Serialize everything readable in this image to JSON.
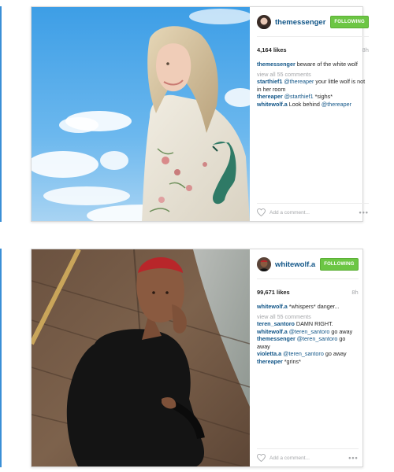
{
  "posts": [
    {
      "username": "themessenger",
      "follow_label": "FOLLOWING",
      "likes": "4,164 likes",
      "time": "8h",
      "caption_user": "themessenger",
      "caption_text": " beware of the white wolf",
      "view_all": "view all 55 comments",
      "comments": [
        {
          "user": "starthief1",
          "mention": " @thereaper",
          "text": " your little wolf is not in her room"
        },
        {
          "user": "thereaper",
          "mention": " @starthief1",
          "text": " *sighs*"
        },
        {
          "user": "whitewolf.a",
          "mention": "",
          "text": " Look behind ",
          "mention_end": "@thereaper"
        }
      ],
      "add_comment_placeholder": "Add a comment...",
      "more_icon": "ellipsis-icon",
      "like_icon": "heart-icon"
    },
    {
      "username": "whitewolf.a",
      "follow_label": "FOLLOWING",
      "likes": "99,671 likes",
      "time": "8h",
      "caption_user": "whitewolf.a",
      "caption_text": " *whispers* danger...",
      "view_all": "view all 55 comments",
      "comments": [
        {
          "user": "teren_santoro",
          "mention": "",
          "text": " DAMN RIGHT."
        },
        {
          "user": "whitewolf.a",
          "mention": " @teren_santoro",
          "text": " go away"
        },
        {
          "user": "themessenger",
          "mention": " @teren_santoro",
          "text": " go away"
        },
        {
          "user": "violetta.a",
          "mention": " @teren_santoro",
          "text": " go away"
        },
        {
          "user": "thereaper",
          "mention": "",
          "text": " *grins*"
        }
      ],
      "add_comment_placeholder": "Add a comment...",
      "more_icon": "ellipsis-icon",
      "like_icon": "heart-icon"
    }
  ],
  "colors": {
    "link_blue": "#125688",
    "follow_green": "#6cc644",
    "muted_gray": "#a5a7aa"
  }
}
